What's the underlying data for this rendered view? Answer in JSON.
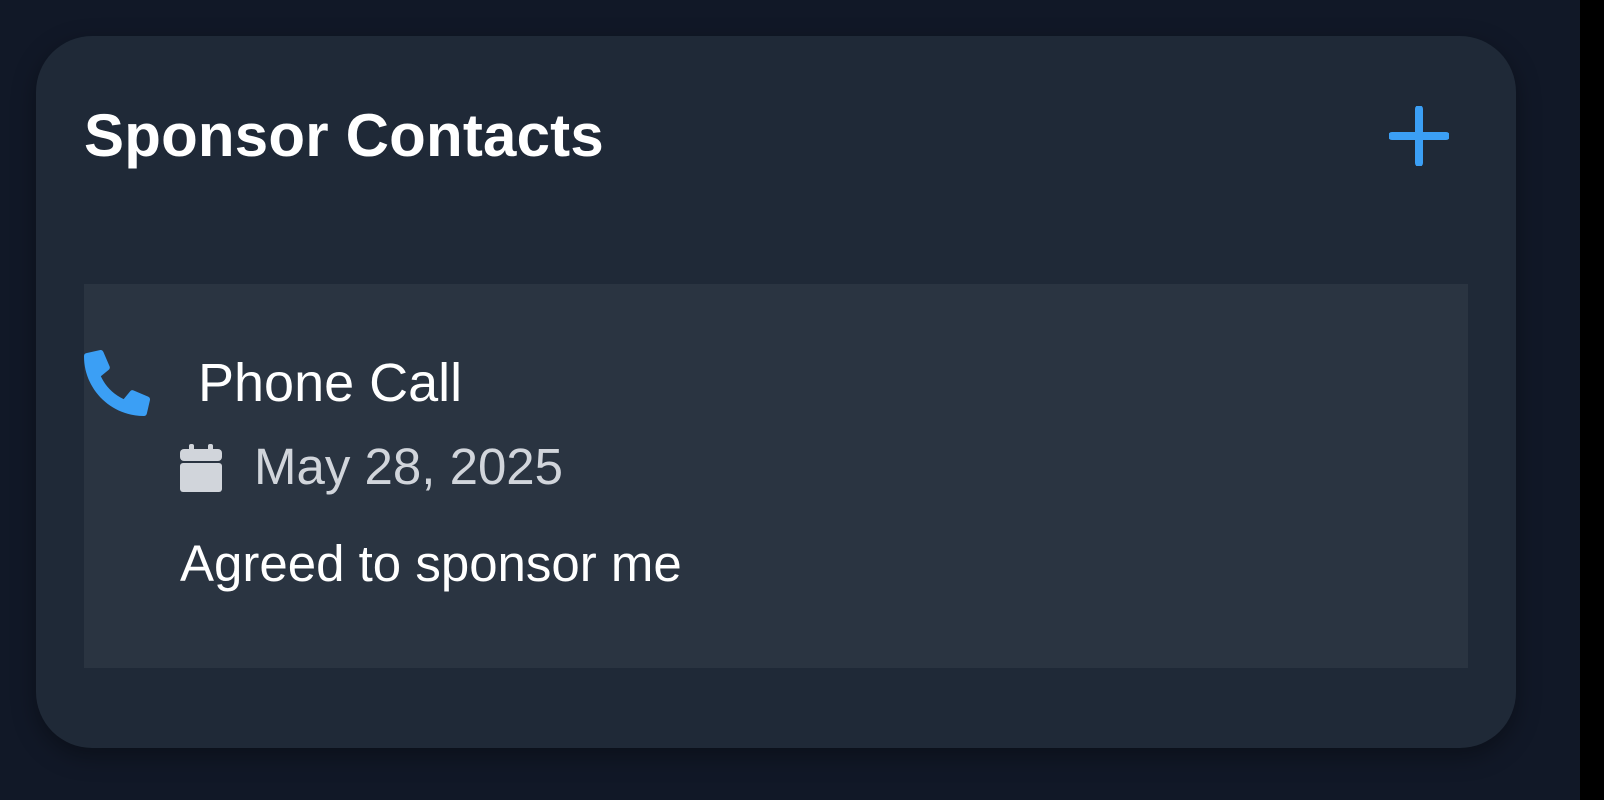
{
  "card": {
    "title": "Sponsor Contacts",
    "add_icon": "plus-icon"
  },
  "contacts": [
    {
      "type": "Phone Call",
      "type_icon": "phone-icon",
      "date": "May 28, 2025",
      "date_icon": "calendar-icon",
      "note": "Agreed to sponsor me"
    }
  ],
  "colors": {
    "page_background": "#111827",
    "card_background": "#1f2937",
    "item_background": "#2a3441",
    "accent": "#3b9ff5",
    "text_primary": "#ffffff",
    "text_secondary": "#d1d5db"
  }
}
